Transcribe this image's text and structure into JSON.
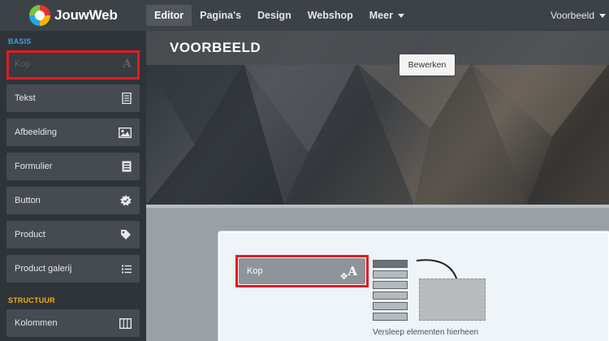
{
  "topbar": {
    "logo_text": "JouwWeb",
    "nav": [
      "Editor",
      "Pagina's",
      "Design",
      "Webshop",
      "Meer"
    ],
    "site_menu": "Voorbeeld"
  },
  "sidebar": {
    "section_basis": "BASIS",
    "section_structuur": "STRUCTUUR",
    "items": [
      {
        "label": "Kop",
        "icon": "heading-A-icon"
      },
      {
        "label": "Tekst",
        "icon": "document-icon"
      },
      {
        "label": "Afbeelding",
        "icon": "image-icon"
      },
      {
        "label": "Formulier",
        "icon": "form-icon"
      },
      {
        "label": "Button",
        "icon": "gear-badge-icon"
      },
      {
        "label": "Product",
        "icon": "tag-icon"
      },
      {
        "label": "Product galerij",
        "icon": "list-icon"
      },
      {
        "label": "Kolommen",
        "icon": "columns-icon"
      }
    ]
  },
  "header": {
    "title": "VOORBEELD",
    "edit_button": "Bewerken"
  },
  "content": {
    "drag_item_label": "Kop",
    "drop_caption": "Versleep elementen hierheen"
  },
  "colors": {
    "highlight": "#e11b22",
    "basis_label": "#3ba0dd",
    "structuur_label": "#f3ae18"
  }
}
